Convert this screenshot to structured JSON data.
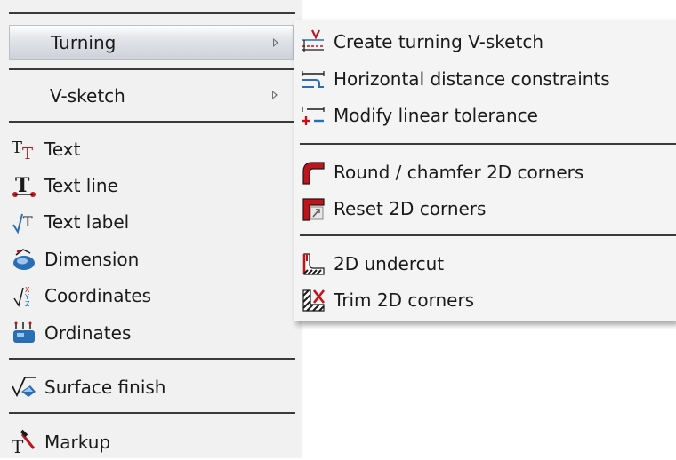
{
  "main_menu": {
    "turning_label": "Turning",
    "vsketch_label": "V-sketch",
    "items": [
      {
        "label": "Text",
        "icon": "text-icon"
      },
      {
        "label": "Text line",
        "icon": "text-line-icon"
      },
      {
        "label": "Text label",
        "icon": "text-label-icon"
      },
      {
        "label": "Dimension",
        "icon": "dimension-icon"
      },
      {
        "label": "Coordinates",
        "icon": "coordinates-icon"
      },
      {
        "label": "Ordinates",
        "icon": "ordinates-icon"
      }
    ],
    "surface_finish_label": "Surface finish",
    "markup_label": "Markup"
  },
  "submenu": {
    "items": [
      {
        "label": "Create turning V-sketch",
        "icon": "turning-vsketch-icon"
      },
      {
        "label": "Horizontal distance constraints",
        "icon": "horizontal-distance-icon"
      },
      {
        "label": "Modify linear tolerance",
        "icon": "linear-tolerance-icon"
      },
      {
        "label": "Round / chamfer 2D corners",
        "icon": "round-chamfer-icon"
      },
      {
        "label": "Reset 2D corners",
        "icon": "reset-corners-icon"
      },
      {
        "label": "2D undercut",
        "icon": "undercut-icon"
      },
      {
        "label": "Trim 2D corners",
        "icon": "trim-corners-icon"
      }
    ]
  },
  "colors": {
    "accent_red": "#c0141c",
    "icon_blue": "#2a6fb5",
    "separator": "#3a3a3a"
  }
}
